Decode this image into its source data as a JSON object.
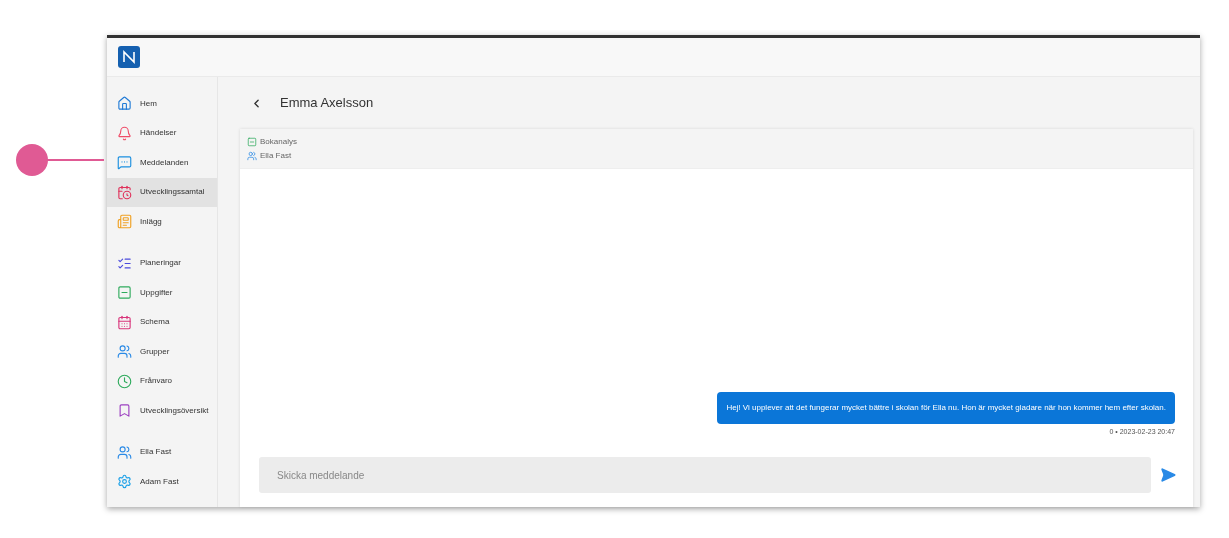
{
  "sidebar": {
    "groups": [
      [
        {
          "label": "Hem",
          "kind": "home",
          "selected": false
        },
        {
          "label": "Händelser",
          "kind": "bell",
          "selected": false
        },
        {
          "label": "Meddelanden",
          "kind": "chat",
          "selected": false
        },
        {
          "label": "Utvecklingssamtal",
          "kind": "meeting",
          "selected": true
        },
        {
          "label": "Inlägg",
          "kind": "post",
          "selected": false
        }
      ],
      [
        {
          "label": "Planeringar",
          "kind": "plan",
          "selected": false
        },
        {
          "label": "Uppgifter",
          "kind": "task",
          "selected": false
        },
        {
          "label": "Schema",
          "kind": "calendar",
          "selected": false
        },
        {
          "label": "Grupper",
          "kind": "group",
          "selected": false
        },
        {
          "label": "Frånvaro",
          "kind": "absence",
          "selected": false
        },
        {
          "label": "Utvecklingsöversikt",
          "kind": "overview",
          "selected": false
        }
      ],
      [
        {
          "label": "Ella Fast",
          "kind": "group",
          "selected": false
        },
        {
          "label": "Adam Fast",
          "kind": "gear",
          "selected": false
        }
      ]
    ]
  },
  "conversation": {
    "title": "Emma Axelsson",
    "tags": [
      {
        "label": "Bokanalys",
        "kind": "task"
      },
      {
        "label": "Ella Fast",
        "kind": "group"
      }
    ],
    "messages": [
      {
        "text": "Hej! Vi upplever att det fungerar mycket bättre i skolan för Ella nu. Hon är mycket gladare när hon kommer hem efter skolan.",
        "meta": "0 • 2023-02-23 20:47"
      }
    ],
    "input": {
      "placeholder": "Skicka meddelande"
    }
  }
}
